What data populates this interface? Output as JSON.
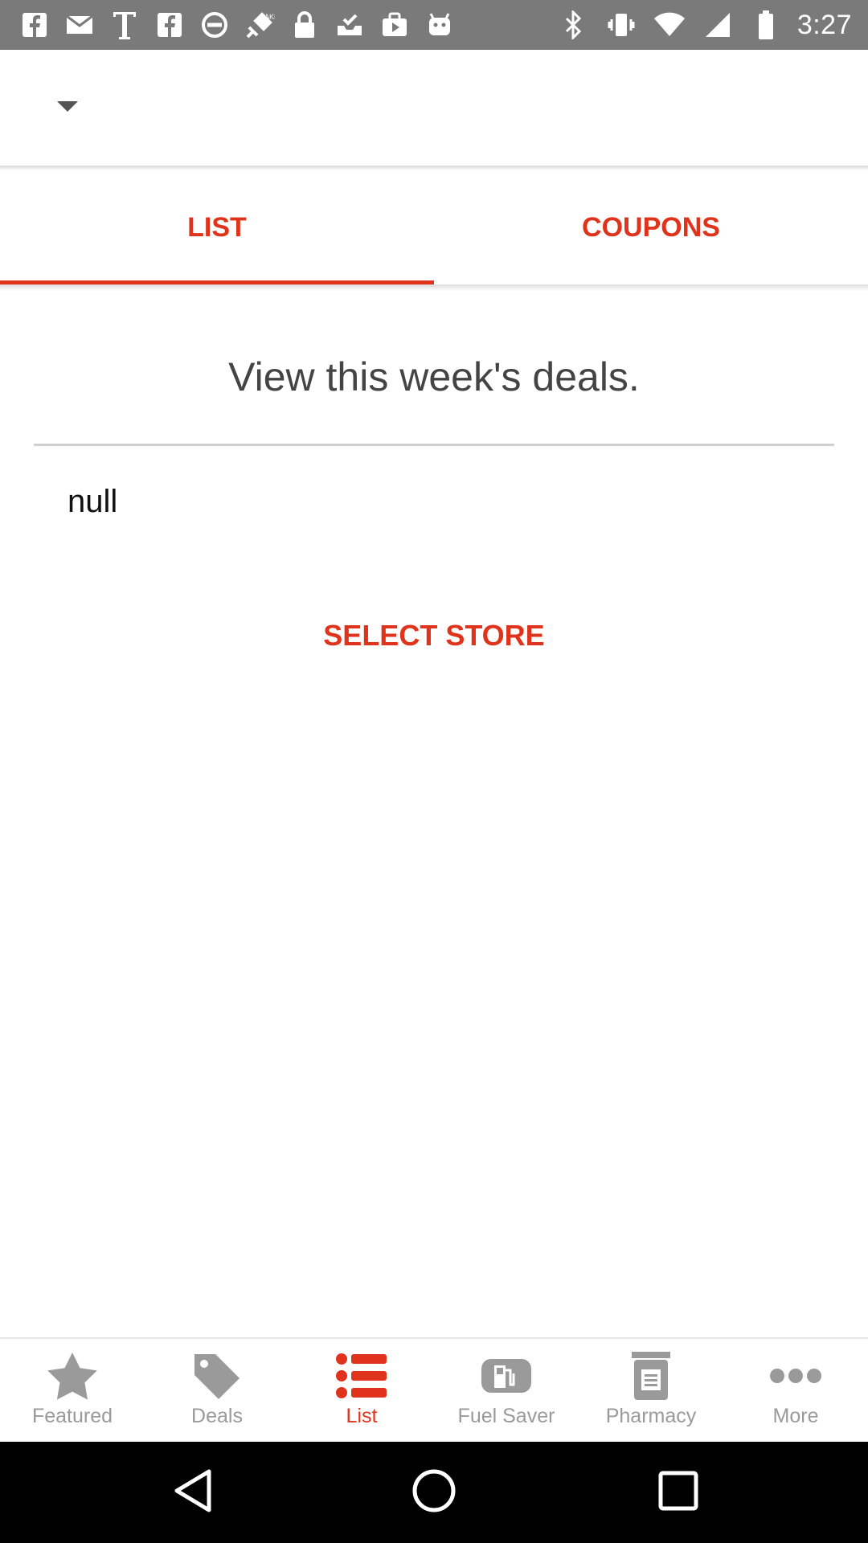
{
  "status_bar": {
    "time": "3:27",
    "left_icons": [
      "facebook-icon",
      "mail-icon",
      "text-icon",
      "facebook-icon",
      "blocked-icon",
      "fake-gps-icon",
      "lock-icon",
      "inbox-check-icon",
      "briefcase-icon",
      "android-icon"
    ],
    "right_icons": [
      "bluetooth-icon",
      "vibrate-icon",
      "wifi-icon",
      "signal-icon",
      "battery-icon"
    ]
  },
  "app_bar": {
    "dropdown_icon": "caret-down-icon"
  },
  "tabs": [
    {
      "label": "LIST",
      "active": true
    },
    {
      "label": "COUPONS",
      "active": false
    }
  ],
  "main": {
    "headline": "View this week's deals.",
    "store_text": "null",
    "select_store_label": "SELECT STORE"
  },
  "bottom_nav": [
    {
      "label": "Featured",
      "icon": "star-icon",
      "active": false
    },
    {
      "label": "Deals",
      "icon": "tag-icon",
      "active": false
    },
    {
      "label": "List",
      "icon": "list-icon",
      "active": true
    },
    {
      "label": "Fuel Saver",
      "icon": "fuel-icon",
      "active": false
    },
    {
      "label": "Pharmacy",
      "icon": "pharmacy-icon",
      "active": false
    },
    {
      "label": "More",
      "icon": "more-icon",
      "active": false
    }
  ],
  "colors": {
    "accent": "#e0331c",
    "inactive": "#9a9a9a",
    "status_bar": "#7a7a7a"
  }
}
